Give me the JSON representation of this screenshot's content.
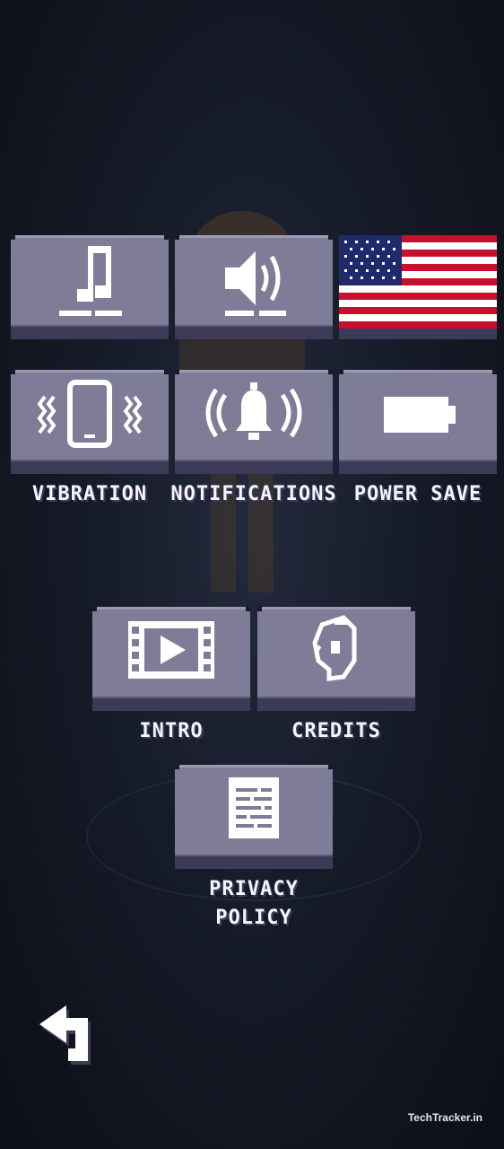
{
  "row_top": {
    "music": {
      "icon": "music-note-icon"
    },
    "sound": {
      "icon": "speaker-icon"
    },
    "language": {
      "icon": "usa-flag-icon"
    }
  },
  "row_settings": [
    {
      "label": "VIBRATION",
      "icon": "phone-vibrate-icon"
    },
    {
      "label": "NOTIFICATIONS",
      "icon": "bell-icon"
    },
    {
      "label": "POWER SAVE",
      "icon": "battery-icon"
    }
  ],
  "row_media": [
    {
      "label": "INTRO",
      "icon": "film-play-icon"
    },
    {
      "label": "CREDITS",
      "icon": "credits-head-icon"
    }
  ],
  "privacy": {
    "label_line1": "PRIVACY",
    "label_line2": "POLICY",
    "icon": "document-icon"
  },
  "navigation": {
    "back_icon": "back-arrow-icon"
  },
  "watermark": {
    "text": "TechTracker.in"
  }
}
